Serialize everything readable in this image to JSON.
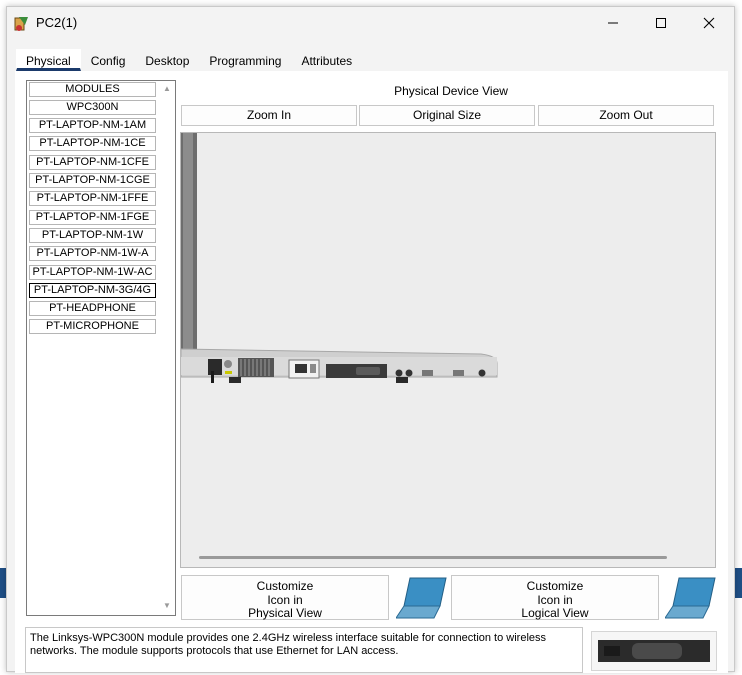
{
  "window": {
    "title": "PC2(1)"
  },
  "tabs": [
    {
      "label": "Physical",
      "active": true
    },
    {
      "label": "Config",
      "active": false
    },
    {
      "label": "Desktop",
      "active": false
    },
    {
      "label": "Programming",
      "active": false
    },
    {
      "label": "Attributes",
      "active": false
    }
  ],
  "modules": {
    "header": "MODULES",
    "items": [
      "WPC300N",
      "PT-LAPTOP-NM-1AM",
      "PT-LAPTOP-NM-1CE",
      "PT-LAPTOP-NM-1CFE",
      "PT-LAPTOP-NM-1CGE",
      "PT-LAPTOP-NM-1FFE",
      "PT-LAPTOP-NM-1FGE",
      "PT-LAPTOP-NM-1W",
      "PT-LAPTOP-NM-1W-A",
      "PT-LAPTOP-NM-1W-AC",
      "PT-LAPTOP-NM-3G/4G",
      "PT-HEADPHONE",
      "PT-MICROPHONE"
    ],
    "selected_index": 10
  },
  "device_view": {
    "title": "Physical Device View",
    "zoom_in": "Zoom In",
    "original_size": "Original Size",
    "zoom_out": "Zoom Out"
  },
  "customize": {
    "physical_lines": [
      "Customize",
      "Icon in",
      "Physical View"
    ],
    "logical_lines": [
      "Customize",
      "Icon in",
      "Logical View"
    ]
  },
  "description": "The Linksys-WPC300N module provides one 2.4GHz wireless interface suitable for connection to wireless networks. The module supports protocols that use Ethernet for LAN access.",
  "colors": {
    "accent": "#1b3a6b",
    "laptop_screen": "#3a8fc4"
  }
}
